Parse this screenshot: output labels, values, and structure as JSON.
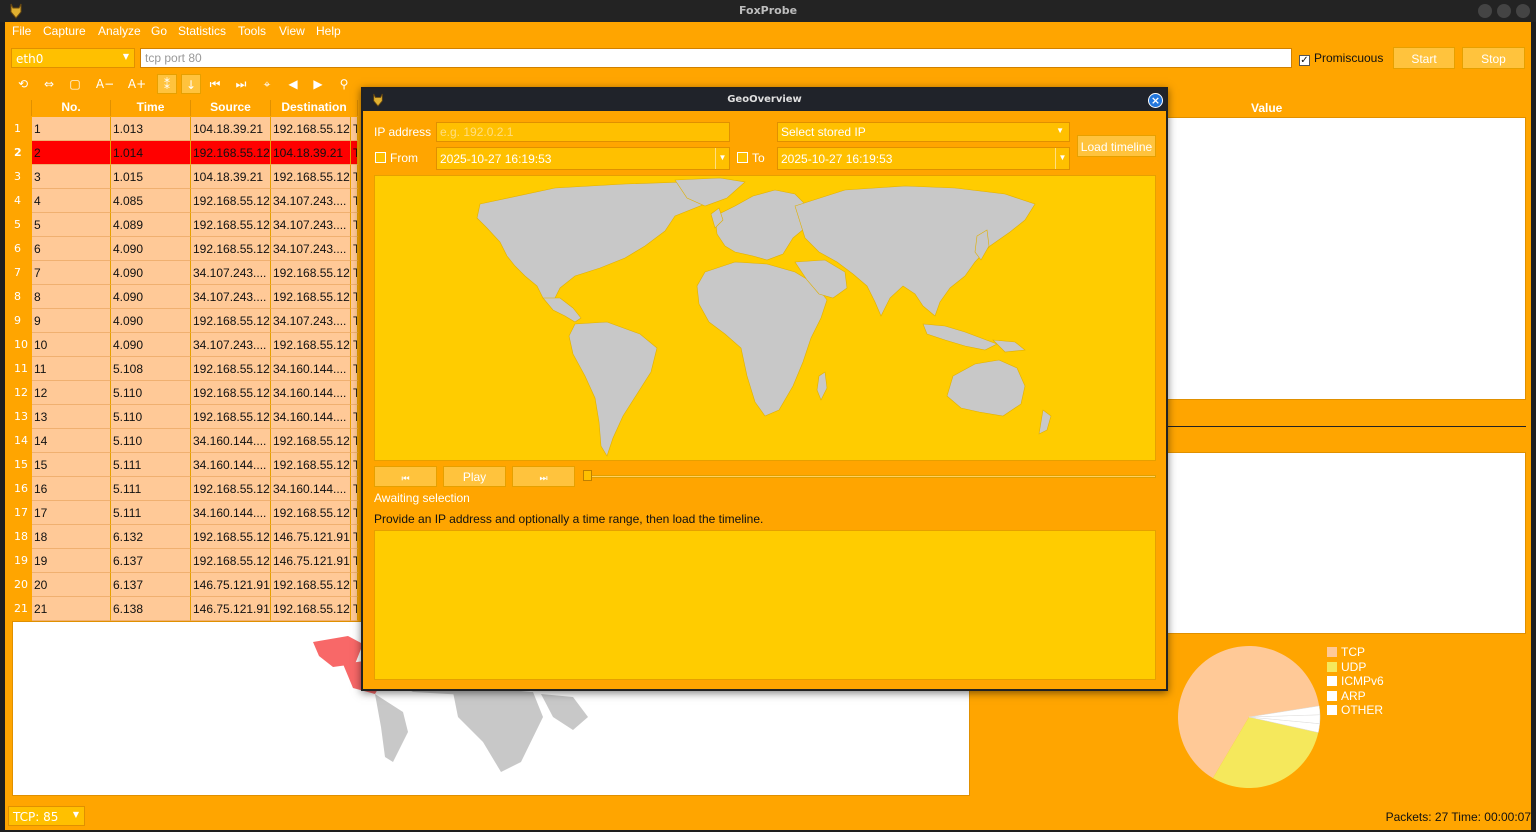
{
  "window": {
    "title": "FoxProbe"
  },
  "menu": [
    "File",
    "Capture",
    "Analyze",
    "Go",
    "Statistics",
    "Tools",
    "View",
    "Help"
  ],
  "capture": {
    "interface": "eth0",
    "filter": "tcp port 80",
    "promiscuous_label": "Promiscuous",
    "promiscuous_checked": true,
    "start_label": "Start",
    "stop_label": "Stop"
  },
  "toolbar": {
    "icons": [
      "reload-icon",
      "swap-icon",
      "stop-square-icon",
      "font-smaller-icon",
      "font-larger-icon",
      "colorize-icon",
      "autoscroll-icon",
      "go-first-icon",
      "go-last-icon",
      "go-to-icon",
      "previous-icon",
      "next-icon",
      "search-icon"
    ],
    "font_smaller": "A−",
    "font_larger": "A+"
  },
  "packet_table": {
    "columns": [
      "No.",
      "Time",
      "Source",
      "Destination"
    ],
    "selected_row": 2,
    "rows": [
      [
        "1",
        "1.013",
        "104.18.39.21",
        "192.168.55.12",
        "T"
      ],
      [
        "2",
        "1.014",
        "192.168.55.12",
        "104.18.39.21",
        "T"
      ],
      [
        "3",
        "1.015",
        "104.18.39.21",
        "192.168.55.12",
        "T"
      ],
      [
        "4",
        "4.085",
        "192.168.55.12",
        "34.107.243....",
        "T"
      ],
      [
        "5",
        "4.089",
        "192.168.55.12",
        "34.107.243....",
        "T"
      ],
      [
        "6",
        "4.090",
        "192.168.55.12",
        "34.107.243....",
        "T"
      ],
      [
        "7",
        "4.090",
        "34.107.243....",
        "192.168.55.12",
        "T"
      ],
      [
        "8",
        "4.090",
        "34.107.243....",
        "192.168.55.12",
        "T"
      ],
      [
        "9",
        "4.090",
        "192.168.55.12",
        "34.107.243....",
        "T"
      ],
      [
        "10",
        "4.090",
        "34.107.243....",
        "192.168.55.12",
        "T"
      ],
      [
        "11",
        "5.108",
        "192.168.55.12",
        "34.160.144....",
        "T"
      ],
      [
        "12",
        "5.110",
        "192.168.55.12",
        "34.160.144....",
        "T"
      ],
      [
        "13",
        "5.110",
        "192.168.55.12",
        "34.160.144....",
        "T"
      ],
      [
        "14",
        "5.110",
        "34.160.144....",
        "192.168.55.12",
        "T"
      ],
      [
        "15",
        "5.111",
        "34.160.144....",
        "192.168.55.12",
        "T"
      ],
      [
        "16",
        "5.111",
        "192.168.55.12",
        "34.160.144....",
        "T"
      ],
      [
        "17",
        "5.111",
        "34.160.144....",
        "192.168.55.12",
        "T"
      ],
      [
        "18",
        "6.132",
        "192.168.55.12",
        "146.75.121.91",
        "T"
      ],
      [
        "19",
        "6.137",
        "192.168.55.12",
        "146.75.121.91",
        "T"
      ],
      [
        "20",
        "6.137",
        "146.75.121.91",
        "192.168.55.12",
        "T"
      ],
      [
        "21",
        "6.138",
        "146.75.121.91",
        "192.168.55.12",
        "T"
      ]
    ]
  },
  "details": {
    "value_header": "Value"
  },
  "protocol_pie": {
    "legend": [
      {
        "name": "TCP",
        "color": "#ffc997"
      },
      {
        "name": "UDP",
        "color": "#f5e85c"
      },
      {
        "name": "ICMPv6",
        "color": "#ffffff"
      },
      {
        "name": "ARP",
        "color": "#ffffff"
      },
      {
        "name": "OTHER",
        "color": "#ffffff"
      }
    ],
    "shares": [
      0.64,
      0.3,
      0.02,
      0.02,
      0.02
    ]
  },
  "statusbar": {
    "protocol_filter": "TCP: 85",
    "summary": "Packets: 27  Time: 00:00:07"
  },
  "geo_dialog": {
    "title": "GeoOverview",
    "ip_label": "IP address",
    "ip_placeholder": "e.g. 192.0.2.1",
    "stored_ip_placeholder": "Select stored IP",
    "load_label": "Load timeline",
    "from_label": "From",
    "from_value": "2025-10-27 16:19:53",
    "to_label": "To",
    "to_value": "2025-10-27 16:19:53",
    "first_label": "⏮",
    "play_label": "Play",
    "last_label": "⏭",
    "status": "Awaiting selection",
    "hint": "Provide an IP address and optionally a time range, then load the timeline."
  },
  "colors": {
    "accent": "#ffa500",
    "selected_row": "#ff0000",
    "row_bg": "#ffc997",
    "map_land": "#c8c8c8",
    "map_highlight": "#f86868"
  }
}
